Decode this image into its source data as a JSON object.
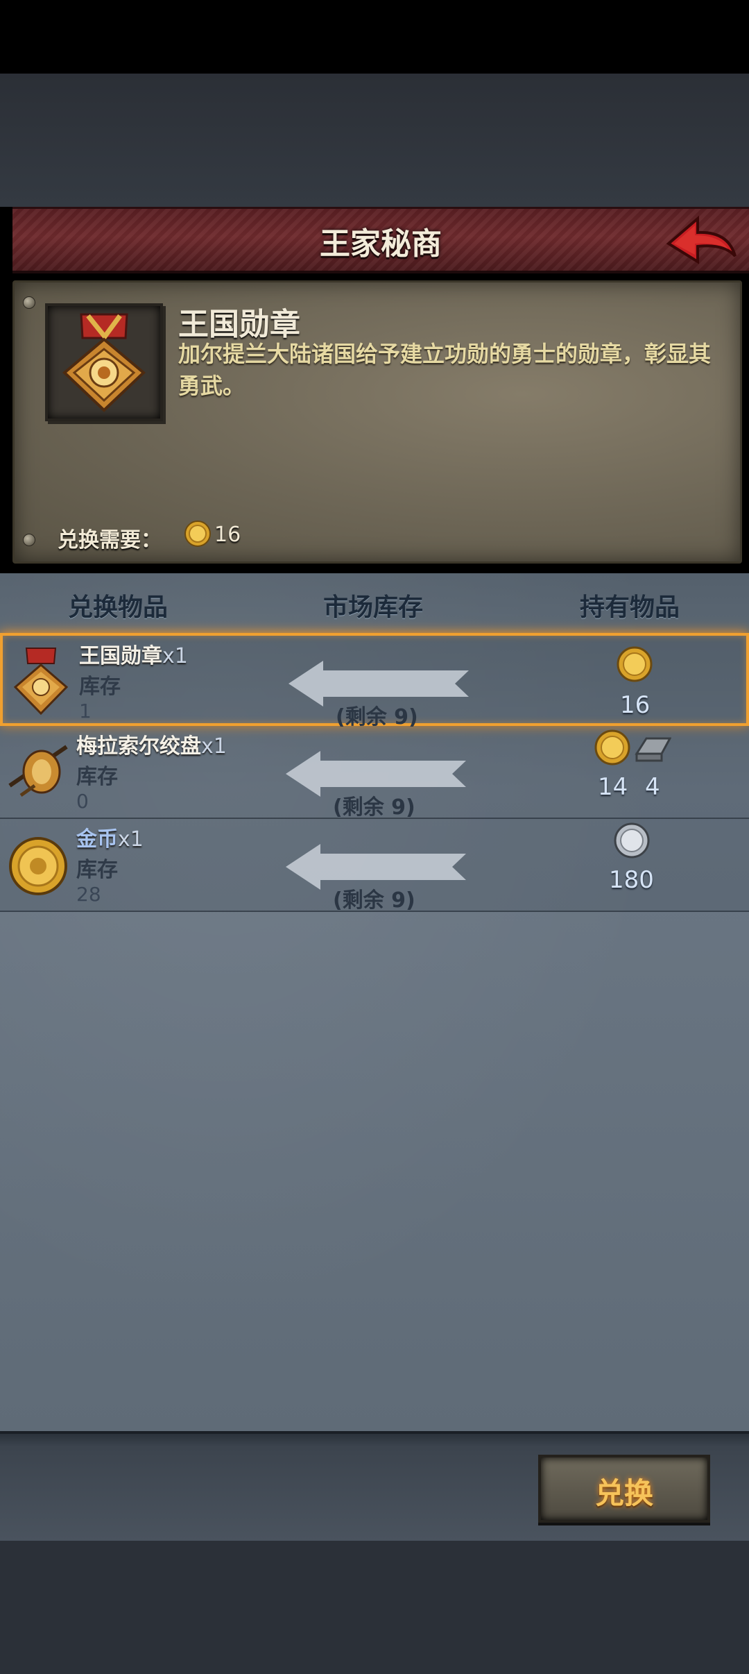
{
  "header": {
    "title": "王家秘商"
  },
  "item_detail": {
    "name": "王国勋章",
    "description": "加尔提兰大陆诸国给予建立功勋的勇士的勋章，彰显其勇武。",
    "requirement_label": "兑换需要：",
    "requirement_value": "16"
  },
  "columns": {
    "exchange": "兑换物品",
    "market": "市场库存",
    "held": "持有物品"
  },
  "rows": [
    {
      "name": "王国勋章",
      "qty": "x1",
      "stock_label": "库存",
      "stock_value": "1",
      "remain": "(剩余 9)",
      "held": [
        {
          "icon": "gold-coin-icon",
          "value": "16"
        }
      ]
    },
    {
      "name": "梅拉索尔绞盘",
      "qty": "x1",
      "stock_label": "库存",
      "stock_value": "0",
      "remain": "(剩余 9)",
      "held": [
        {
          "icon": "gold-coin-icon",
          "value": "14"
        },
        {
          "icon": "iron-ingot-icon",
          "value": "4"
        }
      ]
    },
    {
      "name": "金币",
      "qty": "x1",
      "stock_label": "库存",
      "stock_value": "28",
      "remain": "(剩余 9)",
      "held": [
        {
          "icon": "silver-coin-icon",
          "value": "180"
        }
      ]
    }
  ],
  "footer": {
    "exchange_button": "兑换"
  },
  "colors": {
    "title_bar": "#5a1f23",
    "selected_border": "#f0a030",
    "button_text": "#f6c35a"
  }
}
